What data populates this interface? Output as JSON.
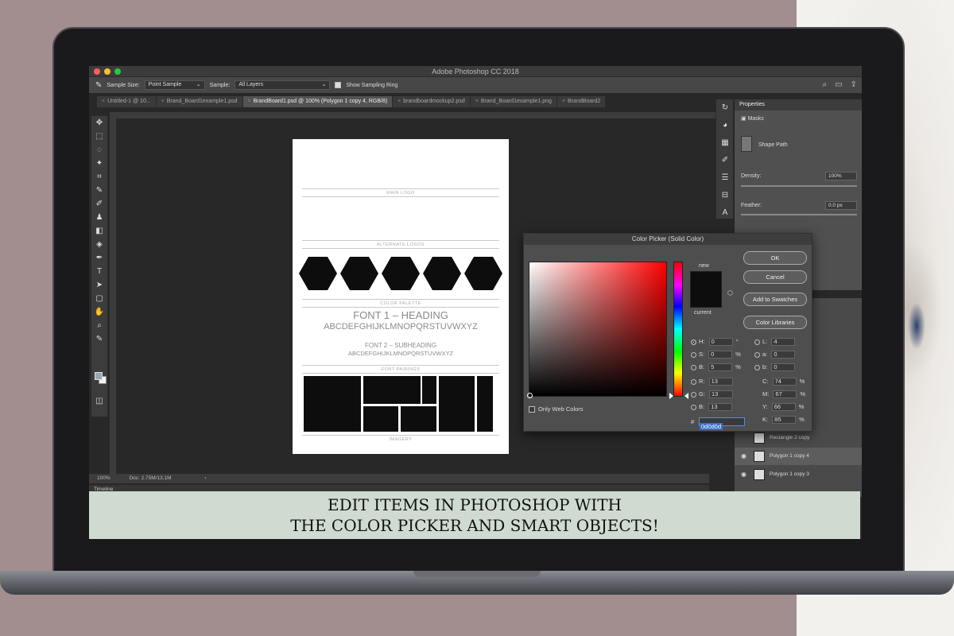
{
  "window": {
    "title": "Adobe Photoshop CC 2018"
  },
  "options_bar": {
    "sample_size_label": "Sample Size:",
    "sample_size_value": "Point Sample",
    "sample_label": "Sample:",
    "sample_value": "All Layers",
    "show_ring_label": "Show Sampling Ring"
  },
  "tabs": [
    "Untitled-1 @ 10...",
    "Brand_Board1example1.psd",
    "BrandBoard1.psd @ 100% (Polygon 1 copy 4, RGB/8)",
    "brandboardmockup2.psd",
    "Brand_Board1example1.png",
    "BrandBoard2"
  ],
  "document": {
    "main_logo": "MAIN LOGO",
    "alternate_logos": "ALTERNATE LOGOS",
    "color_palette": "COLOR PALETTE",
    "font1": "FONT 1 – HEADING",
    "alphabet1": "ABCDEFGHIJKLMNOPQRSTUVWXYZ",
    "font2": "FONT 2 – SUBHEADING",
    "alphabet2": "ABCDEFGHIJKLMNOPQRSTUVWXYZ",
    "font_pairings": "FONT PAIRINGS",
    "imagery": "IMAGERY"
  },
  "status": {
    "zoom": "100%",
    "doc": "Doc: 2.75M/13.1M",
    "timeline": "Timeline"
  },
  "properties": {
    "title": "Properties",
    "masks": "Masks",
    "shape_path": "Shape Path",
    "density_label": "Density:",
    "density_value": "100%",
    "feather_label": "Feather:",
    "feather_value": "0.0 px"
  },
  "layers": [
    {
      "name": "Rectangle 2 copy"
    },
    {
      "name": "Polygon 1 copy 4"
    },
    {
      "name": "Polygon 1 copy 3"
    }
  ],
  "color_picker": {
    "title": "Color Picker (Solid Color)",
    "ok": "OK",
    "cancel": "Cancel",
    "add_swatches": "Add to Swatches",
    "libraries": "Color Libraries",
    "new_label": "new",
    "current_label": "current",
    "only_web": "Only Web Colors",
    "hex_label": "#",
    "hex": "0d0d0d",
    "h": "0",
    "s": "0",
    "b": "5",
    "r": "13",
    "g": "13",
    "bl": "13",
    "l": "4",
    "a": "0",
    "lab_b": "0",
    "c": "74",
    "m": "67",
    "y": "66",
    "k": "85",
    "deg": "°",
    "pct": "%"
  },
  "banner": {
    "line1": "EDIT ITEMS IN PHOTOSHOP WITH",
    "line2": "THE COLOR PICKER AND SMART OBJECTS!"
  }
}
